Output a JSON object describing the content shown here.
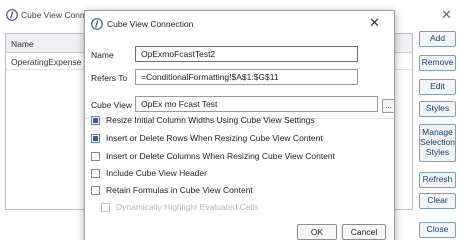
{
  "background": {
    "title": "Cube View Connec",
    "close_glyph": "✕",
    "grid_header": "Name",
    "rows": [
      "OperatingExpense"
    ],
    "buttons": [
      "Add",
      "Remove",
      "Edit",
      "Styles",
      "Manage Selection Styles",
      "Refresh",
      "Clear",
      "Close"
    ]
  },
  "dialog": {
    "title": "Cube View Connection",
    "close_glyph": "✕",
    "name_label": "Name",
    "name_value": "OpExmoFcastTest2",
    "refers_label": "Refers To",
    "refers_value": "=ConditionalFormatting!$A$1:$G$11",
    "cubeview_label": "Cube View",
    "cubeview_value": "OpEx mo Fcast Test",
    "ellipsis": "...",
    "options": [
      {
        "label": "Resize Initial Column Widths Using Cube View Settings",
        "checked": true,
        "enabled": true
      },
      {
        "label": "Insert or Delete Rows When Resizing Cube View Content",
        "checked": true,
        "enabled": true
      },
      {
        "label": "Insert or Delete Columns When Resizing Cube View Content",
        "checked": false,
        "enabled": true
      },
      {
        "label": "Include Cube View Header",
        "checked": false,
        "enabled": true
      },
      {
        "label": "Retain Formulas in Cube View Content",
        "checked": false,
        "enabled": true
      },
      {
        "label": "Dynamically Highlight Evaluated Cells",
        "checked": false,
        "enabled": false
      }
    ],
    "ok_label": "OK",
    "cancel_label": "Cancel"
  },
  "icons": {
    "app": "onestream-logo-icon"
  }
}
